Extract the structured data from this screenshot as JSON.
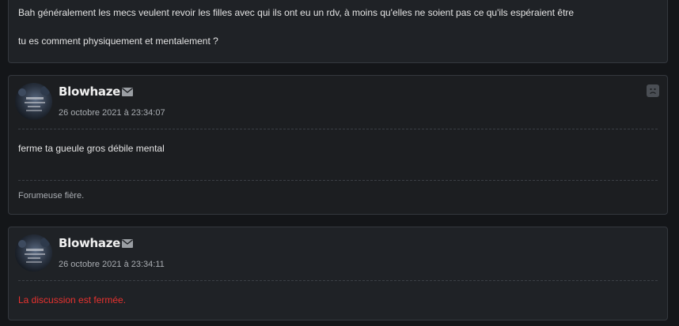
{
  "top_post": {
    "line1": "Bah généralement les mecs veulent revoir les filles avec qui ils ont eu un rdv, à moins qu'elles ne soient pas ce qu'ils espéraient être",
    "line2": "tu es comment physiquement et mentalement ?"
  },
  "posts": [
    {
      "author": "Blowhaze",
      "date": "26 octobre 2021 à 23:34:07",
      "body": "ferme ta gueule gros débile mental",
      "signature": "Forumeuse fière.",
      "avatar_icon": "dark-avatar-image",
      "mail_icon": "envelope-icon",
      "report_icon": "sad-face-icon"
    },
    {
      "author": "Blowhaze",
      "date": "26 octobre 2021 à 23:34:11",
      "body": "La discussion est fermée.",
      "avatar_icon": "dark-avatar-image",
      "mail_icon": "envelope-icon"
    }
  ],
  "colors": {
    "background": "#141619",
    "post_bg": "#1e2125",
    "border": "#34383e",
    "closed_notice": "#e8322f"
  }
}
